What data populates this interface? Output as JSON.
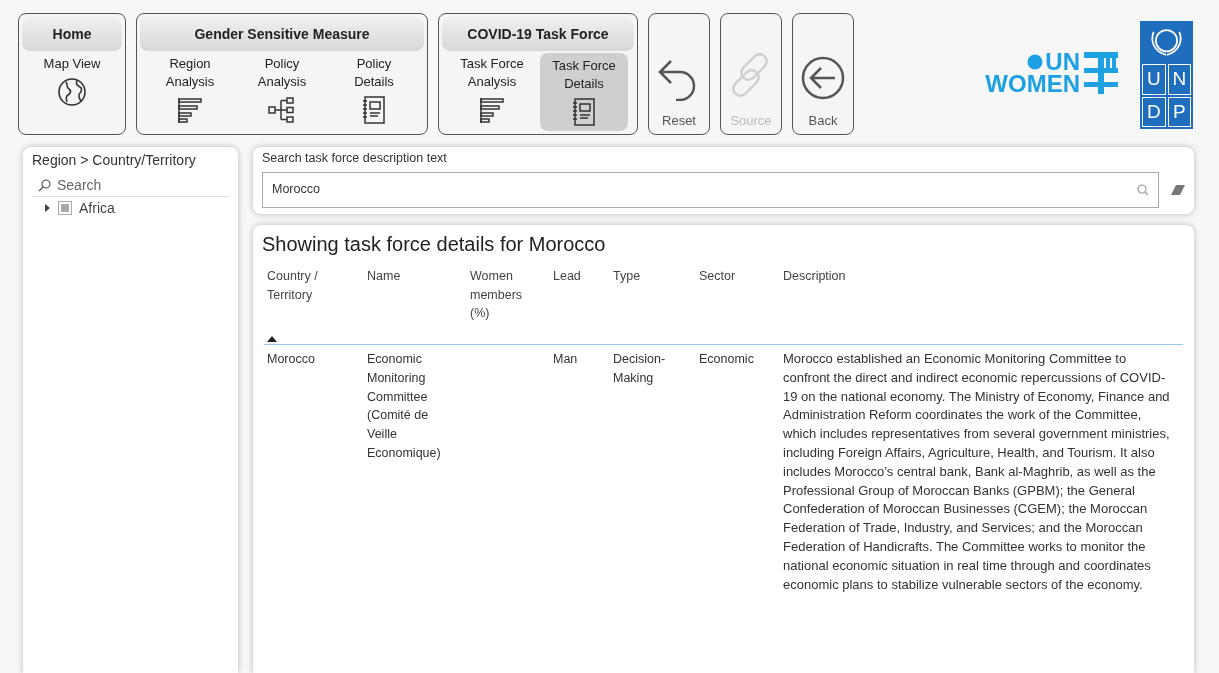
{
  "nav_groups": [
    {
      "title": "Home",
      "items": [
        {
          "label": "Map View",
          "kind": "map",
          "selected": false
        }
      ]
    },
    {
      "title": "Gender Sensitive Measure",
      "items": [
        {
          "label": "Region Analysis",
          "kind": "analysis",
          "selected": false
        },
        {
          "label": "Policy Analysis",
          "kind": "tree",
          "selected": false
        },
        {
          "label": "Policy Details",
          "kind": "details",
          "selected": false
        }
      ]
    },
    {
      "title": "COVID-19 Task Force",
      "items": [
        {
          "label": "Task Force Analysis",
          "kind": "analysis",
          "selected": false
        },
        {
          "label": "Task Force Details",
          "kind": "details",
          "selected": true
        }
      ]
    }
  ],
  "actions": [
    {
      "label": "Reset",
      "kind": "reset",
      "disabled": false
    },
    {
      "label": "Source",
      "kind": "source",
      "disabled": true
    },
    {
      "label": "Back",
      "kind": "back",
      "disabled": false
    }
  ],
  "logos": {
    "un_women": [
      "UN",
      "WOMEN"
    ],
    "undp": [
      "U",
      "N",
      "D",
      "P"
    ]
  },
  "slicer": {
    "title": "Region > Country/Territory",
    "search_placeholder": "Search",
    "items": [
      {
        "label": "Africa",
        "expanded": false,
        "partially_checked": true
      }
    ]
  },
  "search": {
    "label": "Search task force description text",
    "value": "Morocco"
  },
  "table": {
    "title": "Showing task force details for Morocco",
    "columns": [
      {
        "label": "Country / Territory",
        "sorted": true
      },
      {
        "label": "Name",
        "sorted": false
      },
      {
        "label": "Women members (%)",
        "sorted": false
      },
      {
        "label": "Lead",
        "sorted": false
      },
      {
        "label": "Type",
        "sorted": false
      },
      {
        "label": "Sector",
        "sorted": false
      },
      {
        "label": "Description",
        "sorted": false
      }
    ],
    "rows": [
      [
        "Morocco",
        "Economic Monitoring Committee (Comité de Veille Economique)",
        "",
        "Man",
        "Decision-Making",
        "Economic",
        "Morocco established an Economic Monitoring Committee to confront the direct and indirect economic repercussions of COVID-19 on the national economy. The Ministry of Economy, Finance and Administration Reform coordinates the work of the Committee, which includes representatives from several government ministries, including Foreign Affairs, Agriculture, Health, and Tourism. It also includes Morocco’s central bank, Bank al-Maghrib, as well as the Professional Group of Moroccan Banks (GPBM); the General Confederation of Moroccan Businesses (CGEM); the Moroccan Federation of Trade, Industry, and Services; and the Moroccan Federation of Handicrafts. The Committee works to monitor the national economic situation in real time through and coordinates economic plans to stabilize vulnerable sectors of the economy."
      ]
    ]
  }
}
